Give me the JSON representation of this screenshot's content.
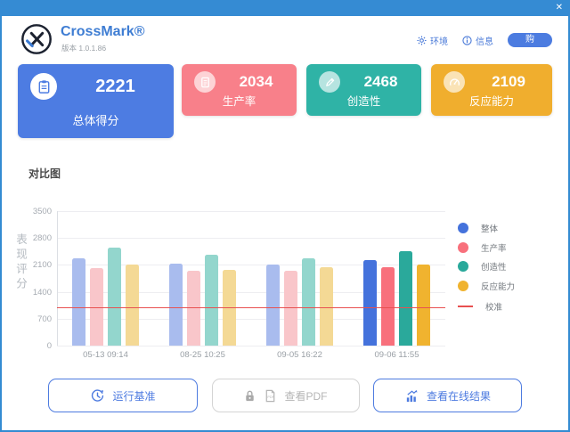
{
  "window": {
    "close_icon": "✕"
  },
  "header": {
    "title": "CrossMark®",
    "version": "版本 1.0.1.86",
    "env_link": "环境",
    "info_link": "信息",
    "buy_label": "购"
  },
  "scores": [
    {
      "value": "2221",
      "label": "总体得分",
      "color": "#4d7ce2",
      "icon": "clipboard"
    },
    {
      "value": "2034",
      "label": "生产率",
      "color": "#f8808a",
      "icon": "document"
    },
    {
      "value": "2468",
      "label": "创造性",
      "color": "#2fb3a6",
      "icon": "pencil"
    },
    {
      "value": "2109",
      "label": "反应能力",
      "color": "#f0ae2e",
      "icon": "gauge"
    }
  ],
  "section_title": "对比图",
  "chart_data": {
    "type": "bar",
    "title": "对比图",
    "ylabel": "表现评分",
    "ylim": [
      0,
      3500
    ],
    "yticks": [
      0,
      700,
      1400,
      2100,
      2800,
      3500
    ],
    "grid": true,
    "legend_position": "right",
    "categories": [
      "05-13 09:14",
      "08-25 10:25",
      "09-05 16:22",
      "09-06 11:55"
    ],
    "highlighted_category": "09-06 11:55",
    "series": [
      {
        "name": "整体",
        "color": "#4472dc",
        "muted_color": "#a9bcee",
        "values": [
          2280,
          2135,
          2110,
          2221
        ]
      },
      {
        "name": "生产率",
        "color": "#f8707c",
        "muted_color": "#f9c6ca",
        "values": [
          2020,
          1945,
          1945,
          2034
        ]
      },
      {
        "name": "创造性",
        "color": "#2aa99b",
        "muted_color": "#93d6cd",
        "values": [
          2560,
          2365,
          2270,
          2468
        ]
      },
      {
        "name": "反应能力",
        "color": "#f0b32f",
        "muted_color": "#f4d995",
        "values": [
          2105,
          1965,
          2040,
          2109
        ]
      }
    ],
    "reference_line": {
      "name": "校准",
      "value": 1000,
      "color": "#e85050"
    }
  },
  "footer": {
    "run_label": "运行基准",
    "pdf_label": "查看PDF",
    "online_label": "查看在线结果"
  }
}
